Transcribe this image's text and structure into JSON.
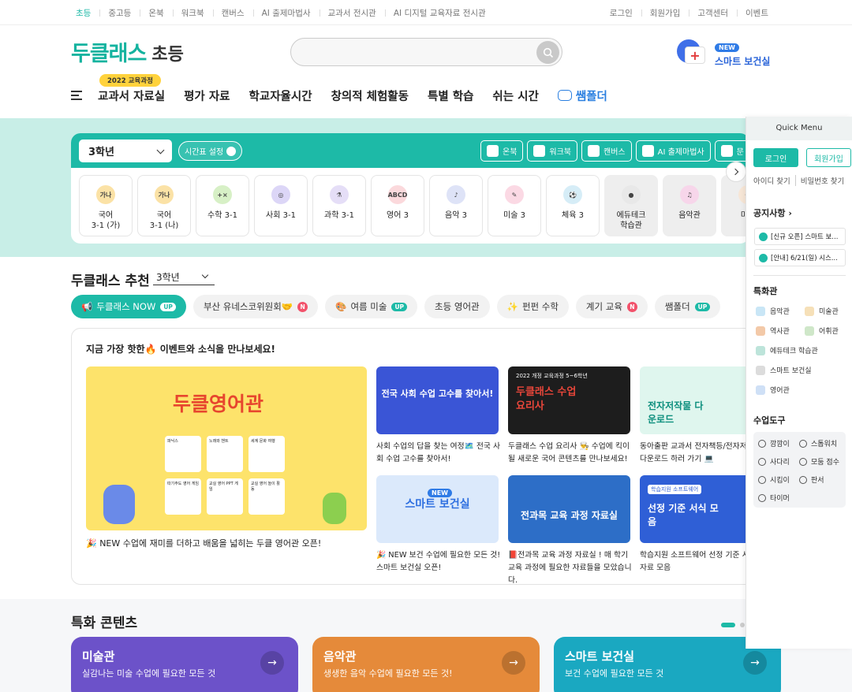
{
  "topbar": {
    "left": [
      "초등",
      "중고등",
      "온북",
      "워크북",
      "캔버스",
      "AI 출제마법사",
      "교과서 전시관",
      "AI 디지털 교육자료 전시관"
    ],
    "right": [
      "로그인",
      "회원가입",
      "고객센터",
      "이벤트"
    ]
  },
  "header": {
    "logo_main": "두클래스",
    "logo_sub": "초등",
    "health_badge": "NEW",
    "health_label": "스마트 보건실"
  },
  "nav": {
    "badge": "2022 교육과정",
    "items": [
      "교과서 자료실",
      "평가 자료",
      "학교자율시간",
      "창의적 체험활동",
      "특별 학습",
      "쉬는 시간"
    ],
    "ssam": "쌤폴더"
  },
  "grade": {
    "selected": "3학년",
    "timetable": "시간표 설정",
    "tools": [
      "온북",
      "워크북",
      "캔버스",
      "AI 출제마법사",
      "문"
    ],
    "subjects": [
      {
        "label1": "국어",
        "label2": "3-1 (가)",
        "icon": "가나",
        "color": "#fbe2a6"
      },
      {
        "label1": "국어",
        "label2": "3-1 (나)",
        "icon": "가나",
        "color": "#fbe2a6"
      },
      {
        "label1": "수학 3-1",
        "label2": "",
        "icon": "+×",
        "color": "#d7f0c6"
      },
      {
        "label1": "사회 3-1",
        "label2": "",
        "icon": "◎",
        "color": "#dcd6f7"
      },
      {
        "label1": "과학 3-1",
        "label2": "",
        "icon": "⚗",
        "color": "#e5def7"
      },
      {
        "label1": "영어 3",
        "label2": "",
        "icon": "ABCD",
        "color": "#fbd9dc"
      },
      {
        "label1": "음악 3",
        "label2": "",
        "icon": "♪",
        "color": "#dee3f7"
      },
      {
        "label1": "미술 3",
        "label2": "",
        "icon": "✎",
        "color": "#fbd9e4"
      },
      {
        "label1": "체육 3",
        "label2": "",
        "icon": "⚽",
        "color": "#d6edf7"
      },
      {
        "label1": "에듀테크",
        "label2": "학습관",
        "icon": "●",
        "color": "#e8e8e8"
      },
      {
        "label1": "음악관",
        "label2": "",
        "icon": "♫",
        "color": "#f7d6ea"
      },
      {
        "label1": "미술",
        "label2": "",
        "icon": "✏",
        "color": "#f7e6d6"
      }
    ]
  },
  "recommend": {
    "title": "두클래스 추천",
    "grade": "3학년",
    "chips": [
      {
        "label": "두클래스 NOW",
        "badge": "UP",
        "emoji": "📢"
      },
      {
        "label": "부산 유네스코위원회🤝",
        "badge": "N",
        "emoji": ""
      },
      {
        "label": "여름 미술",
        "badge": "UP",
        "emoji": "🎨"
      },
      {
        "label": "초등 영어관",
        "badge": "",
        "emoji": ""
      },
      {
        "label": "펀펀 수학",
        "badge": "",
        "emoji": "✨"
      },
      {
        "label": "계기 교육",
        "badge": "N",
        "emoji": ""
      },
      {
        "label": "쌤폴더",
        "badge": "UP",
        "emoji": ""
      }
    ]
  },
  "events": {
    "title": "지금 가장 핫한🔥 이벤트와 소식을 만나보세요!",
    "big_title": "두클영어관",
    "big_caption": "🎉 NEW 수업에 재미를 더하고 배움을 넓히는 두클 영어관 오픈!",
    "cells": [
      "파닉스",
      "노래와 챈트",
      "세계 문화 여행",
      "따기주도 영어 게임",
      "교실 영어 PPT 게임",
      "교실 영어 놀이 활동"
    ],
    "cards": [
      {
        "title": "전국 사회 수업 고수를 찾아서!",
        "caption": "사회 수업의 답을 찾는 여정🗺️ 전국 사회 수업 고수를 찾아서!"
      },
      {
        "title": "두클래스 수업요리사",
        "caption": "두클래스 수업 요리사 👨‍🍳 수업에 킥이 될 새로운 국어 콘텐츠를 만나보세요!"
      },
      {
        "title": "전자저작물 다운로드",
        "caption": "동아출판 교과서 전자책등/전자저작물 다운로드 하러 가기 💻"
      },
      {
        "title": "스마트 보건실",
        "caption": "🎉 NEW 보건 수업에 필요한 모든 것! 스마트 보건실 오픈!"
      },
      {
        "title": "전과목 교육 과정 자료실",
        "caption": "📕전과목 교육 과정 자료실 ! 매 학기 교육 과정에 필요한 자료들을 모았습니다."
      },
      {
        "title": "선정 기준 서식 모음",
        "caption": "학습지원 소프트웨어 선정 기준 서식 자료 모음"
      }
    ],
    "card_badge": "NEW",
    "card_sub2022": "2022 개정 교육과정 5~6학년",
    "card_sub_sw": "학습지원 소프트웨어"
  },
  "featured": {
    "title": "특화 콘텐츠",
    "cards": [
      {
        "name": "미술관",
        "desc": "실감나는 미술 수업에 필요한 모든 것",
        "color": "#6c52c9"
      },
      {
        "name": "음악관",
        "desc": "생생한 음악 수업에 필요한 모든 것!",
        "color": "#e58a3a"
      },
      {
        "name": "스마트 보건실",
        "desc": "보건 수업에 필요한 모든 것",
        "color": "#1aa8c1"
      }
    ]
  },
  "quickmenu": {
    "title": "Quick Menu",
    "login": "로그인",
    "join": "회원가입",
    "find_id": "아이디 찾기",
    "find_pw": "비밀번호 찾기",
    "notice_title": "공지사항",
    "notices": [
      "[신규 오픈] 스마트 보...",
      "[안내] 6/21(일) 시스..."
    ],
    "special_title": "특화관",
    "special": [
      "음악관",
      "미술관",
      "역사관",
      "어휘관",
      "에듀테크 학습관",
      "스마트 보건실",
      "영어관"
    ],
    "tools_title": "수업도구",
    "tools": [
      "깜깜이",
      "스톱워치",
      "사다리",
      "모둠 점수",
      "시킴이",
      "판서",
      "타이머"
    ]
  }
}
